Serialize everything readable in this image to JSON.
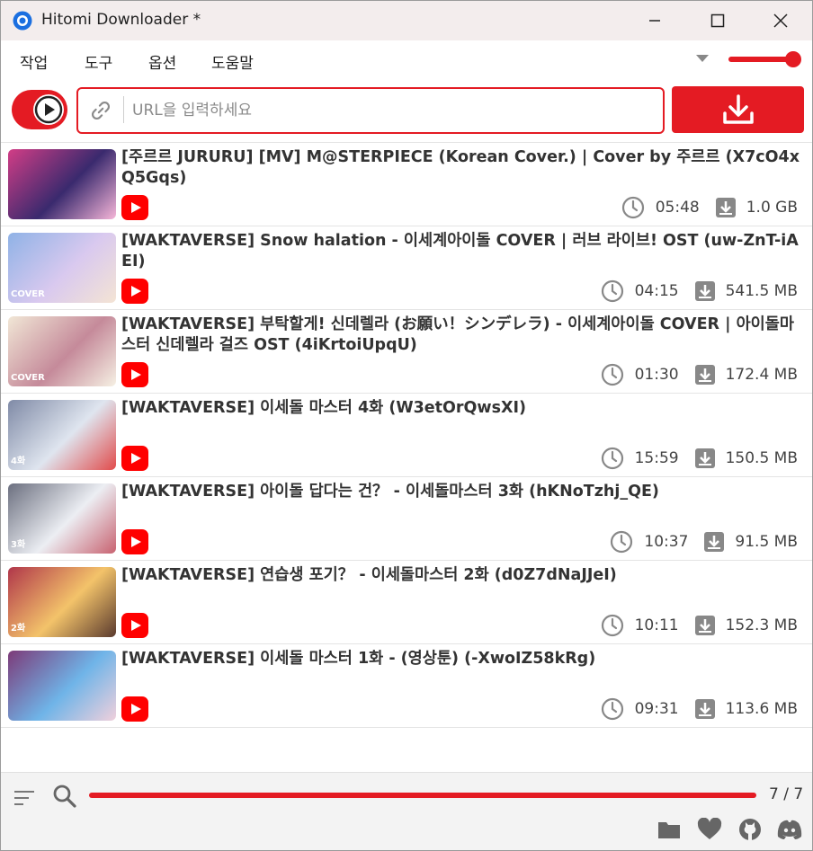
{
  "window": {
    "title": "Hitomi Downloader *"
  },
  "menu": {
    "items": [
      "작업",
      "도구",
      "옵션",
      "도움말"
    ]
  },
  "url_bar": {
    "placeholder": "URL을 입력하세요",
    "value": ""
  },
  "volume": {
    "level": 1.0
  },
  "downloads": [
    {
      "title": "[주르르 JURURU] [MV] M@STERPIECE (Korean Cover.) | Cover by 주르르 (X7cO4xQ5Gqs)",
      "duration": "05:48",
      "size": "1.0 GB",
      "thumb_colors": [
        "#d23d86",
        "#3a2a6e",
        "#f6b6d8"
      ],
      "thumb_tag": ""
    },
    {
      "title": "[WAKTAVERSE] Snow halation - 이세계아이돌 COVER | 러브 라이브! OST (uw-ZnT-iAEI)",
      "duration": "04:15",
      "size": "541.5 MB",
      "thumb_colors": [
        "#8fb2e6",
        "#d9c9ef",
        "#f4e4d4"
      ],
      "thumb_tag": "COVER"
    },
    {
      "title": "[WAKTAVERSE] 부탁할게! 신데렐라 (お願い！シンデレラ) - 이세계아이돌 COVER | 아이돌마스터 신데렐라 걸즈 OST (4iKrtoiUpqU)",
      "duration": "01:30",
      "size": "172.4 MB",
      "thumb_colors": [
        "#f1e7d6",
        "#c58a9a",
        "#f6f1e4"
      ],
      "thumb_tag": "COVER"
    },
    {
      "title": "[WAKTAVERSE] 이세돌 마스터 4화 (W3etOrQwsXI)",
      "duration": "15:59",
      "size": "150.5 MB",
      "thumb_colors": [
        "#7f8aa6",
        "#dfe5ef",
        "#e14b4b"
      ],
      "thumb_tag": "4화"
    },
    {
      "title": "[WAKTAVERSE] 아이돌 답다는 건？ - 이세돌마스터 3화 (hKNoTzhj_QE)",
      "duration": "10:37",
      "size": "91.5 MB",
      "thumb_colors": [
        "#6b6f7f",
        "#eceef3",
        "#c86270"
      ],
      "thumb_tag": "3화"
    },
    {
      "title": "[WAKTAVERSE] 연습생 포기？ - 이세돌마스터 2화 (d0Z7dNaJJeI)",
      "duration": "10:11",
      "size": "152.3 MB",
      "thumb_colors": [
        "#b0364a",
        "#f3c36a",
        "#5a3a2e"
      ],
      "thumb_tag": "2화"
    },
    {
      "title": "[WAKTAVERSE] 이세돌 마스터 1화 - (영상툰) (-XwoIZ58kRg)",
      "duration": "09:31",
      "size": "113.6 MB",
      "thumb_colors": [
        "#7d3a78",
        "#6fb4e8",
        "#f0d0dc"
      ],
      "thumb_tag": ""
    }
  ],
  "footer": {
    "count": "7 / 7",
    "progress": 1.0
  },
  "colors": {
    "accent": "#e41b23",
    "youtube": "#ff0000"
  }
}
